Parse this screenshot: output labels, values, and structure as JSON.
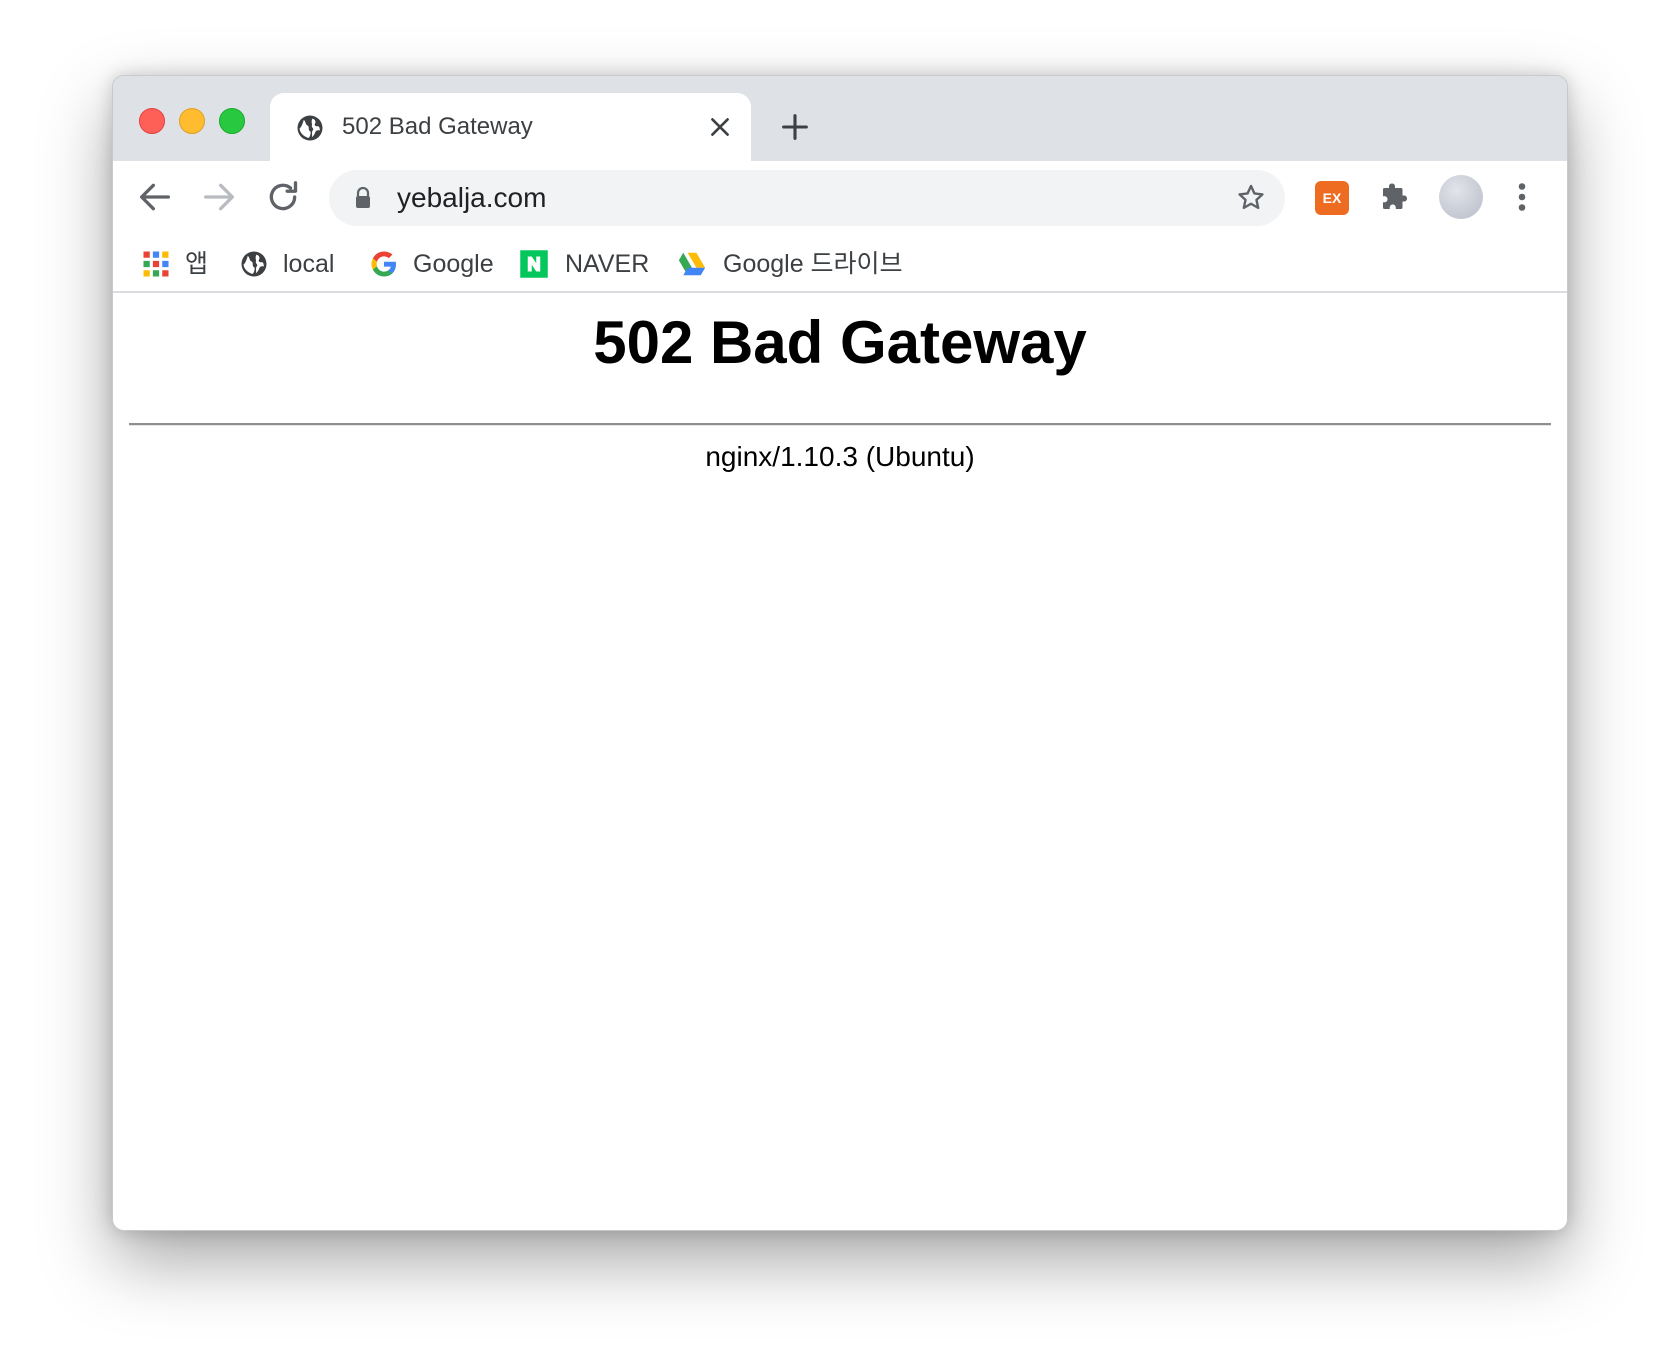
{
  "tab": {
    "title": "502 Bad Gateway",
    "favicon": "globe-icon"
  },
  "toolbar": {
    "url": "yebalja.com",
    "extension_label": "EX",
    "extension_color": "#ee6b22"
  },
  "bookmarks": [
    {
      "label": "앱",
      "icon": "apps-grid-icon"
    },
    {
      "label": "local",
      "icon": "globe-icon"
    },
    {
      "label": "Google",
      "icon": "google-g-icon"
    },
    {
      "label": "NAVER",
      "icon": "naver-icon"
    },
    {
      "label": "Google 드라이브",
      "icon": "google-drive-icon"
    }
  ],
  "page": {
    "heading": "502 Bad Gateway",
    "server_signature": "nginx/1.10.3 (Ubuntu)"
  },
  "colors": {
    "close": "#fe5f57",
    "minimize": "#febc2e",
    "maximize": "#28c840",
    "tabstrip": "#dee1e6",
    "naver": "#03c75a"
  }
}
